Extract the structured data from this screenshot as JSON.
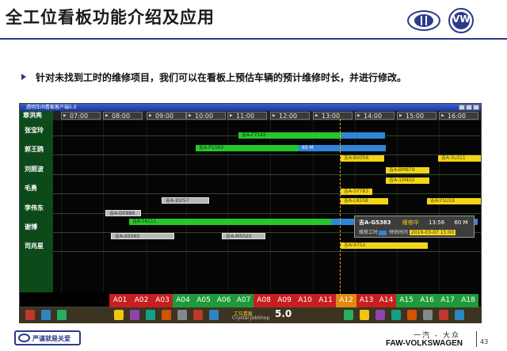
{
  "slide": {
    "title": "全工位看板功能介绍及应用",
    "bullet": "针对未找到工时的维修项目，我们可以在看板上预估车辆的预计维修时长，并进行修改。",
    "logos": {
      "left": "faw-logo",
      "right": "volkswagen-logo",
      "vw_letters": "VW"
    }
  },
  "app": {
    "window_title": "透明车间看板客户端5.0",
    "first_header_name": "章洪亮",
    "time_slots": [
      "07:00",
      "08:00",
      "09:00",
      "10:00",
      "11:00",
      "12:00",
      "13:00",
      "14:00",
      "15:00",
      "16:00"
    ],
    "technicians": [
      "张宝玲",
      "郭王鸥",
      "刘照波",
      "毛勇",
      "李伟东",
      "谢博",
      "司兆星"
    ],
    "bars": [
      {
        "label": "吉A-F7143",
        "color": "green"
      },
      {
        "label": "",
        "color": "blue"
      },
      {
        "label": "吉A-P1583",
        "color": "green"
      },
      {
        "label": "60 M",
        "color": "blue"
      },
      {
        "label": "吉A-BV056",
        "color": "yellow"
      },
      {
        "label": "吉A-5L011",
        "color": "yellow"
      },
      {
        "label": "吉A-BM879",
        "color": "yellow"
      },
      {
        "label": "吉A-1M402",
        "color": "yellow"
      },
      {
        "label": "吉A-5Y783",
        "color": "yellow"
      },
      {
        "label": "吉A-L6558",
        "color": "yellow"
      },
      {
        "label": "吉A-Y1U19",
        "color": "yellow"
      },
      {
        "label": "吉A-J0257",
        "color": "grey"
      },
      {
        "label": "吉A-D0986",
        "color": "grey"
      },
      {
        "label": "吉A-T4111",
        "color": "green"
      },
      {
        "label": "",
        "color": "blue"
      },
      {
        "label": "吉A-X9360",
        "color": "grey"
      },
      {
        "label": "吉A-M5020",
        "color": "grey"
      },
      {
        "label": "吉A-9752",
        "color": "yellow"
      }
    ],
    "popup": {
      "plate": "吉A-G5383",
      "status": "维修中",
      "time_range": "13:56",
      "duration": "60 M",
      "line2_label": "维修工时",
      "line2_mid": "预估时间",
      "line2_value": "2019-03-07 15:00"
    },
    "bays": [
      {
        "label": "A01",
        "color": "#c81e1e"
      },
      {
        "label": "A02",
        "color": "#c81e1e"
      },
      {
        "label": "A03",
        "color": "#c81e1e"
      },
      {
        "label": "A04",
        "color": "#1e9a3a"
      },
      {
        "label": "A05",
        "color": "#1e9a3a"
      },
      {
        "label": "A06",
        "color": "#1e9a3a"
      },
      {
        "label": "A07",
        "color": "#1e9a3a"
      },
      {
        "label": "A08",
        "color": "#c81e1e"
      },
      {
        "label": "A09",
        "color": "#c81e1e"
      },
      {
        "label": "A10",
        "color": "#c81e1e"
      },
      {
        "label": "A11",
        "color": "#c81e1e"
      },
      {
        "label": "A12",
        "color": "#e08a10"
      },
      {
        "label": "A13",
        "color": "#c81e1e"
      },
      {
        "label": "A14",
        "color": "#c81e1e"
      },
      {
        "label": "A15",
        "color": "#1e9a3a"
      },
      {
        "label": "A16",
        "color": "#1e9a3a"
      },
      {
        "label": "A17",
        "color": "#1e9a3a"
      },
      {
        "label": "A18",
        "color": "#1e9a3a"
      }
    ],
    "toolbar": {
      "label": "工位看板",
      "brand": "Crystal JobShop",
      "version": "5.0"
    }
  },
  "footer": {
    "left_logo_text": "严谨就是关爱",
    "brand_cn": "一汽 - 大众",
    "brand_en": "FAW-VOLKSWAGEN",
    "page": "43"
  }
}
